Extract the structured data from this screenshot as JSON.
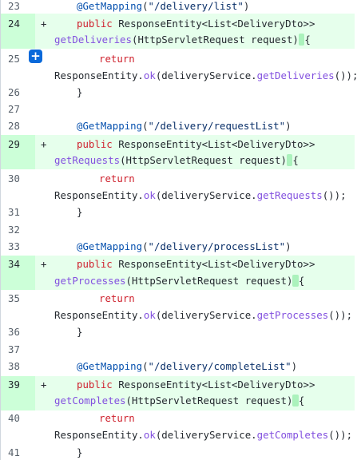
{
  "lines": {
    "n23": "23",
    "n24": "24",
    "n25": "25",
    "n26": "26",
    "n27": "27",
    "n28": "28",
    "n29": "29",
    "n30": "30",
    "n31": "31",
    "n32": "32",
    "n33": "33",
    "n34": "34",
    "n35": "35",
    "n36": "36",
    "n37": "37",
    "n38": "38",
    "n39": "39",
    "n40": "40",
    "n41": "41"
  },
  "plus": "+",
  "add_comment_icon": "+",
  "code": {
    "at_get": "@GetMapping",
    "open_paren": "(",
    "close_paren": ")",
    "path_list": "\"/delivery/list\"",
    "path_request": "\"/delivery/requestList\"",
    "path_process": "\"/delivery/processList\"",
    "path_complete": "\"/delivery/completeList\"",
    "kw_public": "public",
    "kw_return": "return",
    "response_type": " ResponseEntity<List<DeliveryDto>>",
    "fn_getDeliveries": "getDeliveries",
    "fn_getRequests": "getRequests",
    "fn_getProcesses": "getProcesses",
    "fn_getCompletes": "getCompletes",
    "params": "(HttpServletRequest request)",
    "space": " ",
    "brace_open": "{",
    "brace_close": "}",
    "resp_prefix": "ResponseEntity.",
    "ok": "ok",
    "svc": "(deliveryService.",
    "call_end": "());"
  },
  "colors": {
    "added_bg": "#e6ffec",
    "added_gutter": "#ccffd8",
    "keyword": "#cf222e",
    "function": "#8250df",
    "annotation": "#0550ae",
    "string": "#0a3069",
    "button": "#0969da"
  }
}
